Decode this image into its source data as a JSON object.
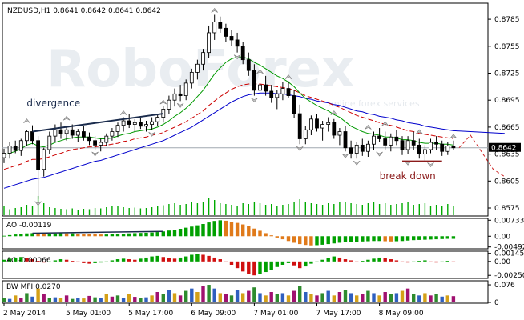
{
  "chart_data": {
    "type": "candlestick",
    "symbol_header": "NZDUSD,H1  0.8641 0.8642 0.8641 0.8642",
    "watermark": "RoboForex",
    "watermark_sub": "online forex services",
    "current_price_label": "0.8642",
    "current_price": 0.8642,
    "price_axis": {
      "ticks": [
        "0.8785",
        "0.8755",
        "0.8725",
        "0.8695",
        "0.8665",
        "0.8635",
        "0.8605",
        "0.8575"
      ],
      "range": [
        0.8567,
        0.8802
      ]
    },
    "x_axis": {
      "ticks": [
        "2 May 2014",
        "5 May 01:00",
        "5 May 17:00",
        "6 May 09:00",
        "7 May 01:00",
        "7 May 17:00",
        "8 May 09:00"
      ]
    },
    "ohlc": [
      [
        0.8631,
        0.8641,
        0.8625,
        0.8636
      ],
      [
        0.8636,
        0.8648,
        0.863,
        0.8644
      ],
      [
        0.8644,
        0.865,
        0.8636,
        0.8639
      ],
      [
        0.8639,
        0.8652,
        0.8633,
        0.865
      ],
      [
        0.865,
        0.8662,
        0.8644,
        0.866
      ],
      [
        0.866,
        0.8667,
        0.8646,
        0.865
      ],
      [
        0.865,
        0.8655,
        0.8585,
        0.8618
      ],
      [
        0.8618,
        0.8642,
        0.861,
        0.864
      ],
      [
        0.864,
        0.866,
        0.8635,
        0.8655
      ],
      [
        0.8655,
        0.8668,
        0.8648,
        0.8662
      ],
      [
        0.8662,
        0.867,
        0.8652,
        0.8658
      ],
      [
        0.8658,
        0.8666,
        0.865,
        0.8662
      ],
      [
        0.8662,
        0.8668,
        0.8652,
        0.8656
      ],
      [
        0.8656,
        0.8663,
        0.8648,
        0.866
      ],
      [
        0.866,
        0.8666,
        0.865,
        0.8654
      ],
      [
        0.8654,
        0.8659,
        0.8645,
        0.865
      ],
      [
        0.865,
        0.8655,
        0.864,
        0.8645
      ],
      [
        0.8645,
        0.8652,
        0.8638,
        0.8648
      ],
      [
        0.8648,
        0.8658,
        0.8644,
        0.8655
      ],
      [
        0.8655,
        0.8664,
        0.865,
        0.866
      ],
      [
        0.866,
        0.867,
        0.8654,
        0.8667
      ],
      [
        0.8667,
        0.8676,
        0.866,
        0.8672
      ],
      [
        0.8672,
        0.868,
        0.8664,
        0.8668
      ],
      [
        0.8668,
        0.8674,
        0.866,
        0.867
      ],
      [
        0.867,
        0.8675,
        0.8663,
        0.8666
      ],
      [
        0.8666,
        0.8672,
        0.866,
        0.8668
      ],
      [
        0.8668,
        0.8676,
        0.8662,
        0.8671
      ],
      [
        0.8671,
        0.868,
        0.8666,
        0.8676
      ],
      [
        0.8676,
        0.8688,
        0.867,
        0.8685
      ],
      [
        0.8685,
        0.87,
        0.868,
        0.8695
      ],
      [
        0.8695,
        0.8708,
        0.8688,
        0.8702
      ],
      [
        0.8702,
        0.8712,
        0.8694,
        0.87
      ],
      [
        0.87,
        0.8718,
        0.8695,
        0.8714
      ],
      [
        0.8714,
        0.873,
        0.8708,
        0.8726
      ],
      [
        0.8726,
        0.874,
        0.8718,
        0.8735
      ],
      [
        0.8735,
        0.8752,
        0.8728,
        0.8748
      ],
      [
        0.8748,
        0.8778,
        0.8742,
        0.877
      ],
      [
        0.877,
        0.879,
        0.8762,
        0.8782
      ],
      [
        0.8782,
        0.8788,
        0.877,
        0.8775
      ],
      [
        0.8775,
        0.878,
        0.876,
        0.8766
      ],
      [
        0.8766,
        0.8773,
        0.8755,
        0.8762
      ],
      [
        0.8762,
        0.877,
        0.8748,
        0.8755
      ],
      [
        0.8755,
        0.876,
        0.8735,
        0.874
      ],
      [
        0.874,
        0.8748,
        0.8722,
        0.8728
      ],
      [
        0.8728,
        0.8735,
        0.87,
        0.8706
      ],
      [
        0.8706,
        0.872,
        0.869,
        0.8712
      ],
      [
        0.8712,
        0.8722,
        0.87,
        0.8705
      ],
      [
        0.8705,
        0.8712,
        0.8692,
        0.8698
      ],
      [
        0.8698,
        0.8706,
        0.8685,
        0.8702
      ],
      [
        0.8702,
        0.8715,
        0.8695,
        0.8708
      ],
      [
        0.8708,
        0.8716,
        0.8698,
        0.87
      ],
      [
        0.87,
        0.8706,
        0.8675,
        0.868
      ],
      [
        0.868,
        0.869,
        0.8646,
        0.8652
      ],
      [
        0.8652,
        0.8666,
        0.8646,
        0.8662
      ],
      [
        0.8662,
        0.8678,
        0.8656,
        0.8674
      ],
      [
        0.8674,
        0.868,
        0.866,
        0.8664
      ],
      [
        0.8664,
        0.8672,
        0.865,
        0.8668
      ],
      [
        0.8668,
        0.8676,
        0.866,
        0.867
      ],
      [
        0.867,
        0.8674,
        0.8652,
        0.8656
      ],
      [
        0.8656,
        0.8664,
        0.8645,
        0.866
      ],
      [
        0.866,
        0.8666,
        0.8638,
        0.8642
      ],
      [
        0.8642,
        0.865,
        0.863,
        0.8636
      ],
      [
        0.8636,
        0.8648,
        0.863,
        0.8645
      ],
      [
        0.8645,
        0.8652,
        0.8633,
        0.8638
      ],
      [
        0.8638,
        0.865,
        0.8632,
        0.8646
      ],
      [
        0.8646,
        0.866,
        0.864,
        0.8655
      ],
      [
        0.8655,
        0.8664,
        0.8648,
        0.8652
      ],
      [
        0.8652,
        0.866,
        0.864,
        0.8645
      ],
      [
        0.8645,
        0.8658,
        0.8638,
        0.8654
      ],
      [
        0.8654,
        0.8662,
        0.8645,
        0.865
      ],
      [
        0.865,
        0.8655,
        0.8634,
        0.864
      ],
      [
        0.864,
        0.8655,
        0.8635,
        0.865
      ],
      [
        0.865,
        0.866,
        0.864,
        0.8645
      ],
      [
        0.8645,
        0.8652,
        0.863,
        0.8635
      ],
      [
        0.8635,
        0.8645,
        0.8628,
        0.864
      ],
      [
        0.864,
        0.8652,
        0.8636,
        0.8648
      ],
      [
        0.8648,
        0.8655,
        0.864,
        0.8646
      ],
      [
        0.8646,
        0.865,
        0.8633,
        0.8638
      ],
      [
        0.8638,
        0.8648,
        0.8634,
        0.8644
      ],
      [
        0.8644,
        0.865,
        0.864,
        0.8642
      ]
    ],
    "ma_green": [
      0.8634,
      0.8636,
      0.8638,
      0.8641,
      0.8645,
      0.8647,
      0.8644,
      0.8643,
      0.8645,
      0.8648,
      0.865,
      0.8652,
      0.8653,
      0.8654,
      0.8654,
      0.8654,
      0.8653,
      0.8652,
      0.8652,
      0.8653,
      0.8655,
      0.8657,
      0.8658,
      0.866,
      0.8661,
      0.8662,
      0.8663,
      0.8665,
      0.8668,
      0.8672,
      0.8677,
      0.8681,
      0.8686,
      0.8692,
      0.8699,
      0.8706,
      0.8715,
      0.8724,
      0.8731,
      0.8737,
      0.8741,
      0.8743,
      0.8743,
      0.8741,
      0.8737,
      0.8734,
      0.873,
      0.8726,
      0.8722,
      0.8719,
      0.8715,
      0.871,
      0.8703,
      0.8697,
      0.8693,
      0.8689,
      0.8686,
      0.8683,
      0.8679,
      0.8676,
      0.8671,
      0.8666,
      0.8663,
      0.866,
      0.8658,
      0.8657,
      0.8656,
      0.8654,
      0.8654,
      0.8653,
      0.8651,
      0.8651,
      0.865,
      0.8648,
      0.8647,
      0.8647,
      0.8647,
      0.8646,
      0.8646,
      0.8645
    ],
    "ma_red": [
      0.8618,
      0.862,
      0.8622,
      0.8624,
      0.8627,
      0.8629,
      0.8629,
      0.863,
      0.8632,
      0.8634,
      0.8636,
      0.8638,
      0.864,
      0.8641,
      0.8642,
      0.8643,
      0.8643,
      0.8644,
      0.8645,
      0.8646,
      0.8647,
      0.8649,
      0.865,
      0.8652,
      0.8653,
      0.8654,
      0.8656,
      0.8657,
      0.8659,
      0.8662,
      0.8665,
      0.8668,
      0.8671,
      0.8675,
      0.8679,
      0.8683,
      0.8689,
      0.8694,
      0.8699,
      0.8703,
      0.8707,
      0.871,
      0.8712,
      0.8713,
      0.8713,
      0.8713,
      0.8712,
      0.8711,
      0.871,
      0.8709,
      0.8708,
      0.8706,
      0.8703,
      0.87,
      0.8698,
      0.8696,
      0.8694,
      0.8692,
      0.8689,
      0.8687,
      0.8684,
      0.8681,
      0.8678,
      0.8676,
      0.8674,
      0.8672,
      0.867,
      0.8668,
      0.8667,
      0.8665,
      0.8663,
      0.8661,
      0.866,
      0.8658,
      0.8657,
      0.8656,
      0.8655,
      0.8654,
      0.8653,
      0.8652
    ],
    "ma_blue": [
      0.8597,
      0.8599,
      0.8601,
      0.8603,
      0.8605,
      0.8607,
      0.8608,
      0.8609,
      0.8611,
      0.8613,
      0.8615,
      0.8617,
      0.8619,
      0.8621,
      0.8623,
      0.8625,
      0.8627,
      0.8628,
      0.863,
      0.8632,
      0.8634,
      0.8636,
      0.8638,
      0.864,
      0.8642,
      0.8644,
      0.8646,
      0.8648,
      0.865,
      0.8653,
      0.8656,
      0.8659,
      0.8662,
      0.8665,
      0.8669,
      0.8673,
      0.8677,
      0.8681,
      0.8685,
      0.8689,
      0.8693,
      0.8696,
      0.8699,
      0.8701,
      0.8702,
      0.8703,
      0.8703,
      0.8703,
      0.8702,
      0.8702,
      0.8701,
      0.87,
      0.8699,
      0.8697,
      0.8696,
      0.8694,
      0.8693,
      0.8692,
      0.869,
      0.8689,
      0.8687,
      0.8685,
      0.8683,
      0.8682,
      0.868,
      0.8679,
      0.8677,
      0.8676,
      0.8675,
      0.8673,
      0.8672,
      0.867,
      0.8669,
      0.8668,
      0.8666,
      0.8665,
      0.8664,
      0.8663,
      0.8662,
      0.8661
    ],
    "ma_blue_extension": [
      [
        79,
        0.8661
      ],
      [
        82,
        0.866
      ],
      [
        85,
        0.8659
      ],
      [
        88,
        0.8658
      ]
    ],
    "forecast_dashed": [
      [
        80,
        0.8642
      ],
      [
        82,
        0.8656
      ],
      [
        86,
        0.8618
      ],
      [
        88,
        0.861
      ]
    ],
    "divergence_line": [
      [
        5,
        0.866
      ],
      [
        28,
        0.868
      ]
    ],
    "breakdown_line": [
      [
        70,
        0.8627
      ],
      [
        77,
        0.8627
      ]
    ],
    "fractals_up": [
      [
        4,
        0.8667
      ],
      [
        11,
        0.867
      ],
      [
        21,
        0.8676
      ],
      [
        28,
        0.8688
      ],
      [
        37,
        0.879
      ],
      [
        45,
        0.8722
      ],
      [
        50,
        0.8716
      ],
      [
        58,
        0.8676
      ],
      [
        64,
        0.866
      ],
      [
        67,
        0.8664
      ],
      [
        73,
        0.8655
      ],
      [
        79,
        0.865
      ]
    ],
    "fractals_down": [
      [
        6,
        0.8585
      ],
      [
        16,
        0.864
      ],
      [
        26,
        0.8662
      ],
      [
        31,
        0.8694
      ],
      [
        41,
        0.8748
      ],
      [
        44,
        0.87
      ],
      [
        52,
        0.8646
      ],
      [
        60,
        0.8638
      ],
      [
        62,
        0.863
      ],
      [
        66,
        0.864
      ],
      [
        71,
        0.863
      ],
      [
        75,
        0.8628
      ]
    ],
    "annotations": [
      {
        "text": "divergence",
        "at": [
          4,
          0.8688
        ],
        "color": "#1a2b4c"
      },
      {
        "text": "break down",
        "at": [
          66,
          0.8607
        ],
        "color": "#8b1a1a"
      }
    ],
    "volume": [
      22,
      15,
      18,
      20,
      26,
      24,
      48,
      30,
      20,
      18,
      16,
      15,
      17,
      14,
      16,
      15,
      18,
      17,
      20,
      22,
      24,
      20,
      18,
      19,
      17,
      18,
      20,
      22,
      25,
      28,
      30,
      26,
      28,
      32,
      30,
      34,
      42,
      38,
      30,
      28,
      26,
      24,
      30,
      28,
      34,
      30,
      26,
      28,
      24,
      26,
      28,
      32,
      40,
      34,
      30,
      28,
      26,
      30,
      28,
      32,
      34,
      30,
      28,
      26,
      30,
      32,
      28,
      30,
      26,
      28,
      30,
      34,
      26,
      28,
      30,
      24,
      26,
      22,
      28,
      24
    ],
    "volume_ticks": [],
    "indicators": [
      {
        "label": "AO -0.00119",
        "ticks": [
          "0.00733",
          "0.00",
          "-0.00492"
        ],
        "range": [
          -0.0054,
          0.0078
        ],
        "tick_values": [
          0.00733,
          0.0,
          -0.00492
        ],
        "values": [
          0.0002,
          0.0005,
          0.0008,
          0.0011,
          0.0013,
          0.0014,
          0.0012,
          0.0011,
          0.0012,
          0.0013,
          0.0014,
          0.0013,
          0.0013,
          0.0012,
          0.0011,
          0.001,
          0.0009,
          0.0008,
          0.0008,
          0.0009,
          0.001,
          0.0012,
          0.0013,
          0.0014,
          0.0015,
          0.0016,
          0.0017,
          0.0019,
          0.0022,
          0.0026,
          0.003,
          0.0034,
          0.0039,
          0.0044,
          0.005,
          0.0056,
          0.0063,
          0.007,
          0.0073,
          0.0071,
          0.0067,
          0.0061,
          0.0054,
          0.0045,
          0.0035,
          0.0025,
          0.0014,
          0.0004,
          -0.0006,
          -0.0014,
          -0.0022,
          -0.003,
          -0.0036,
          -0.004,
          -0.0042,
          -0.0041,
          -0.0039,
          -0.0036,
          -0.0033,
          -0.003,
          -0.0028,
          -0.0026,
          -0.0025,
          -0.0024,
          -0.0023,
          -0.0022,
          -0.0022,
          -0.0023,
          -0.0024,
          -0.0023,
          -0.0022,
          -0.002,
          -0.0018,
          -0.0017,
          -0.0016,
          -0.0015,
          -0.0014,
          -0.0013,
          -0.0012,
          -0.0012
        ],
        "divergence_line": [
          [
            5,
            0.0014
          ],
          [
            28,
            0.0022
          ]
        ]
      },
      {
        "label": "AC -0.00066",
        "ticks": [
          "0.001457",
          "0.00",
          "-0.00250"
        ],
        "range": [
          -0.0029,
          0.0017
        ],
        "tick_values": [
          0.001457,
          0.0,
          -0.0025
        ],
        "values": [
          0.0003,
          0.0005,
          0.0007,
          0.0008,
          0.0006,
          0.0004,
          0.0001,
          -0.0002,
          -0.0001,
          0.0002,
          0.0004,
          0.0003,
          0.0001,
          -0.0001,
          -0.0003,
          -0.0004,
          -0.0003,
          -0.0002,
          0.0,
          0.0002,
          0.0004,
          0.0005,
          0.0004,
          0.0003,
          0.0005,
          0.0007,
          0.0009,
          0.001,
          0.0008,
          0.0006,
          0.0005,
          0.0007,
          0.0009,
          0.0012,
          0.0014,
          0.0012,
          0.001,
          0.0007,
          0.0004,
          0.0,
          -0.0006,
          -0.0012,
          -0.0018,
          -0.0022,
          -0.0025,
          -0.0023,
          -0.0019,
          -0.0015,
          -0.001,
          -0.0006,
          -0.0003,
          -0.0007,
          -0.0012,
          -0.0009,
          -0.0004,
          0.0,
          0.0003,
          0.0006,
          0.0009,
          0.0007,
          0.0004,
          0.0002,
          -0.0001,
          0.0001,
          0.0003,
          0.0005,
          0.0007,
          0.0006,
          0.0004,
          0.0002,
          0.0,
          -0.0002,
          -0.0001,
          0.0001,
          0.0002,
          0.0,
          -0.0002,
          -0.0001,
          0.0001,
          -0.0001
        ]
      },
      {
        "label": "BW MFI 0.0270",
        "ticks": [
          "0.076",
          "0"
        ],
        "range": [
          0,
          0.09
        ],
        "tick_values": [
          0.076,
          0
        ],
        "values": [
          0.02,
          0.015,
          0.03,
          0.018,
          0.04,
          0.025,
          0.06,
          0.035,
          0.02,
          0.022,
          0.018,
          0.03,
          0.015,
          0.02,
          0.017,
          0.028,
          0.022,
          0.018,
          0.035,
          0.025,
          0.03,
          0.02,
          0.038,
          0.024,
          0.018,
          0.022,
          0.03,
          0.045,
          0.035,
          0.055,
          0.04,
          0.03,
          0.05,
          0.06,
          0.045,
          0.07,
          0.076,
          0.06,
          0.04,
          0.035,
          0.03,
          0.055,
          0.04,
          0.05,
          0.065,
          0.04,
          0.03,
          0.045,
          0.035,
          0.04,
          0.03,
          0.05,
          0.07,
          0.045,
          0.035,
          0.03,
          0.04,
          0.05,
          0.03,
          0.045,
          0.055,
          0.04,
          0.03,
          0.035,
          0.05,
          0.04,
          0.03,
          0.045,
          0.035,
          0.04,
          0.05,
          0.06,
          0.035,
          0.03,
          0.04,
          0.03,
          0.035,
          0.025,
          0.03,
          0.027
        ]
      }
    ],
    "colors": {
      "bull": "#ffffff",
      "bear": "#000000",
      "ma_green": "#009900",
      "ma_red": "#cc0000",
      "ma_blue": "#0000cc",
      "forecast": "#cc2222",
      "divergence": "#1a2b4c",
      "breakdown": "#8b1a1a",
      "volume": "#00aa00",
      "up": "#00a000",
      "down": "#d01010",
      "down_alt": "#e07a1a",
      "mfi_a": "#2e8b2e",
      "mfi_b": "#2f5fbf",
      "mfi_c": "#d4a017",
      "mfi_d": "#a01070",
      "grid": "#000000",
      "price_line": "#a0a8b0"
    }
  }
}
